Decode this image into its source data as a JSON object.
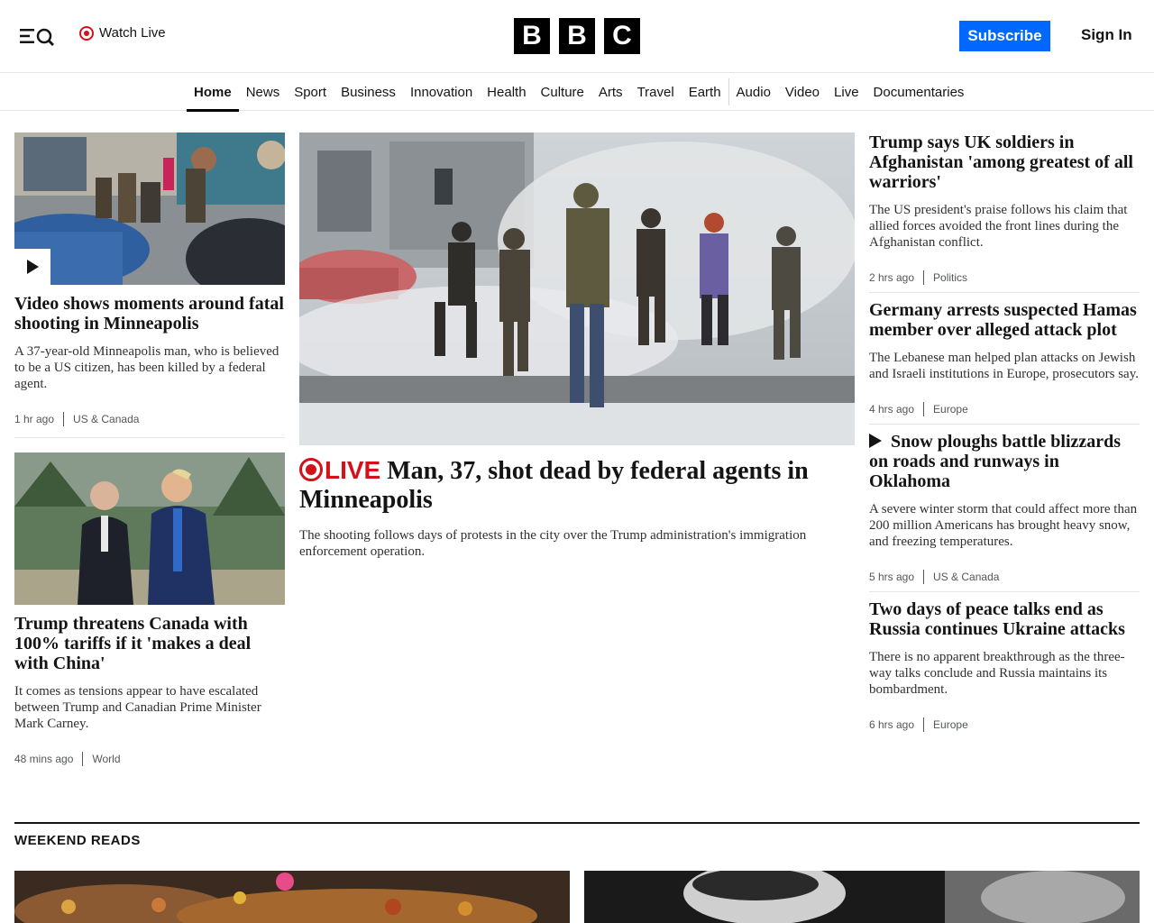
{
  "header": {
    "watch_live": "Watch Live",
    "logo_letters": [
      "B",
      "B",
      "C"
    ],
    "subscribe": "Subscribe",
    "sign_in": "Sign In"
  },
  "nav": {
    "items": [
      "Home",
      "News",
      "Sport",
      "Business",
      "Innovation",
      "Health",
      "Culture",
      "Arts",
      "Travel",
      "Earth",
      "Audio",
      "Video",
      "Live",
      "Documentaries"
    ],
    "active": "Home"
  },
  "left": [
    {
      "title": "Video shows moments around fatal shooting in Minneapolis",
      "desc": "A 37-year-old Minneapolis man, who is believed to be a US citizen, has been killed by a federal agent.",
      "time": "1 hr ago",
      "category": "US & Canada"
    },
    {
      "title": "Trump threatens Canada with 100% tariffs if it 'makes a deal with China'",
      "desc": "It comes as tensions appear to have escalated between Trump and Canadian Prime Minister Mark Carney.",
      "time": "48 mins ago",
      "category": "World"
    }
  ],
  "hero": {
    "live_label": "LIVE",
    "title": "Man, 37, shot dead by federal agents in Minneapolis",
    "desc": "The shooting follows days of protests in the city over the Trump administration's immigration enforcement operation."
  },
  "right": [
    {
      "title": "Trump says UK soldiers in Afghanistan 'among greatest of all warriors'",
      "desc": "The US president's praise follows his claim that allied forces avoided the front lines during the Afghanistan conflict.",
      "time": "2 hrs ago",
      "category": "Politics"
    },
    {
      "title": "Germany arrests suspected Hamas member over alleged attack plot",
      "desc": "The Lebanese man helped plan attacks on Jewish and Israeli institutions in Europe, prosecutors say.",
      "time": "4 hrs ago",
      "category": "Europe"
    },
    {
      "title": "Snow ploughs battle blizzards on roads and runways in Oklahoma",
      "desc": "A severe winter storm that could affect more than 200 million Americans has brought heavy snow, and freezing temperatures.",
      "time": "5 hrs ago",
      "category": "US & Canada"
    },
    {
      "title": "Two days of peace talks end as Russia continues Ukraine attacks",
      "desc": "There is no apparent breakthrough as the three-way talks conclude and Russia maintains its bombardment.",
      "time": "6 hrs ago",
      "category": "Europe"
    }
  ],
  "weekend": {
    "title": "WEEKEND READS"
  },
  "colors": {
    "live_red": "#d4101a",
    "subscribe_blue": "#0068ff"
  }
}
